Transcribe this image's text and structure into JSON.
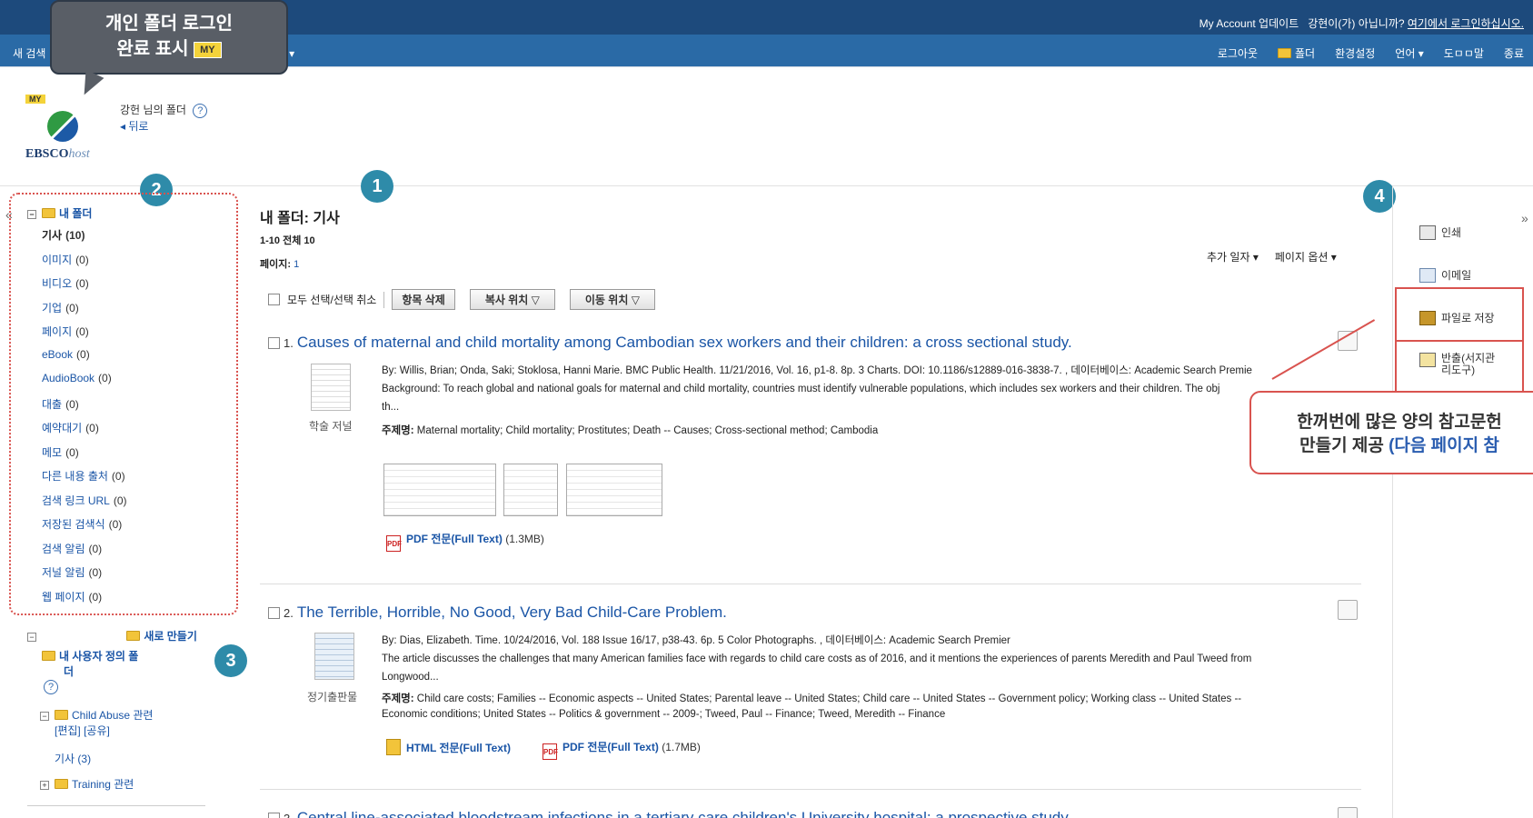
{
  "header": {
    "account_text": "My Account 업데이트",
    "not_user_text": "강현이(가) 아닙니까?",
    "login_link": "여기에서 로그인하십시오.",
    "new_search": "새 검색",
    "partial_menu": "기 ▾",
    "menu": [
      "로그아웃",
      "폴더",
      "환경설정",
      "언어 ▾",
      "도ㅁㅁ말",
      "종료"
    ]
  },
  "callout_login": {
    "line1": "개인 폴더 로그인",
    "line2": "완료 표시",
    "badge": "MY"
  },
  "branding": {
    "my_badge": "MY",
    "logo_main": "EBSCO",
    "logo_sub": "host",
    "folder_owner": "강헌 님의 폴더",
    "help": "?",
    "back": "◂ 뒤로"
  },
  "numbers": [
    "1",
    "2",
    "3",
    "4"
  ],
  "sidebar": {
    "collapse": "«",
    "root": "내 폴더",
    "items": [
      {
        "label": "기사",
        "count": "(10)"
      },
      {
        "label": "이미지",
        "count": "(0)"
      },
      {
        "label": "비디오",
        "count": "(0)"
      },
      {
        "label": "기업",
        "count": "(0)"
      },
      {
        "label": "페이지",
        "count": "(0)"
      },
      {
        "label": "eBook",
        "count": "(0)"
      },
      {
        "label": "AudioBook",
        "count": "(0)"
      },
      {
        "label": "대출",
        "count": "(0)"
      },
      {
        "label": "예약대기",
        "count": "(0)"
      },
      {
        "label": "메모",
        "count": "(0)"
      },
      {
        "label": "다른 내용 출처",
        "count": "(0)"
      },
      {
        "label": "검색 링크 URL",
        "count": "(0)"
      },
      {
        "label": "저장된 검색식",
        "count": "(0)"
      },
      {
        "label": "검색 알림",
        "count": "(0)"
      },
      {
        "label": "저널 알림",
        "count": "(0)"
      },
      {
        "label": "웹 페이지",
        "count": "(0)"
      }
    ],
    "new_folder": "새로 만들기",
    "custom_folder_line1": "내 사용자 정의 폴",
    "custom_folder_line2": "더",
    "help": "?",
    "child_abuse": "Child Abuse 관련",
    "edit_share": "[편집] [공유]",
    "child_articles": "기사 (3)",
    "training": "Training 관련"
  },
  "main": {
    "title": "내 폴더: 기사",
    "range": "1-10 전체 10",
    "page_label": "페이지:",
    "page_num": "1",
    "sort_added": "추가 일자 ▾",
    "page_options": "페이지 옵션 ▾",
    "select_all": "모두 선택/선택 취소",
    "delete_btn": "항목 삭제",
    "copy_btn": "복사 위치 ▽",
    "move_btn": "이동 위치 ▽"
  },
  "results": [
    {
      "num": "1.",
      "title": "Causes of maternal and child mortality among Cambodian sex workers and their children: a cross sectional study.",
      "byline": "By: Willis, Brian; Onda, Saki; Stoklosa, Hanni Marie. BMC Public Health. 11/21/2016, Vol. 16, p1-8. 8p. 3 Charts. DOI: 10.1186/s12889-016-3838-7. , 데이터베이스: Academic Search Premie",
      "abstract": "Background: To reach global and national goals for maternal and child mortality, countries must identify vulnerable populations, which includes sex workers and their children. The obj",
      "abstract2": "th...",
      "subject_label": "주제명:",
      "subjects": "Maternal mortality; Child mortality; Prostitutes; Death -- Causes; Cross-sectional method; Cambodia",
      "type": "학술 저널",
      "pdf_label": "PDF 전문(Full Text)",
      "pdf_size": "(1.3MB)"
    },
    {
      "num": "2.",
      "title": "The Terrible, Horrible, No Good, Very Bad Child-Care Problem.",
      "byline": "By: Dias, Elizabeth. Time. 10/24/2016, Vol. 188 Issue 16/17, p38-43. 6p. 5 Color Photographs. , 데이터베이스: Academic Search Premier",
      "abstract": "The article discusses the challenges that many American families face with regards to child care costs as of 2016, and it mentions the experiences of parents Meredith and Paul Tweed from",
      "abstract2": "Longwood...",
      "subject_label": "주제명:",
      "subjects": "Child care costs; Families -- Economic aspects -- United States; Parental leave -- United States; Child care -- United States -- Government policy; Working class -- United States --",
      "subjects2": "Economic conditions; United States -- Politics & government -- 2009-; Tweed, Paul -- Finance; Tweed, Meredith -- Finance",
      "type": "정기출판물",
      "html_label": "HTML 전문(Full Text)",
      "pdf_label": "PDF 전문(Full Text)",
      "pdf_size": "(1.7MB)"
    },
    {
      "num": "3.",
      "title": "Central line-associated bloodstream infections in a tertiary care children's University hospital: a prospective study."
    }
  ],
  "tools": {
    "collapse": "»",
    "print": "인쇄",
    "email": "이메일",
    "save": "파일로 저장",
    "export_line1": "반출(서지관",
    "export_line2": "리도구)"
  },
  "callout_export": {
    "line1": "한꺼번에 많은 양의 참고문헌",
    "line2a": "만들기 제공 ",
    "line2b": "(다음 페이지 참"
  }
}
